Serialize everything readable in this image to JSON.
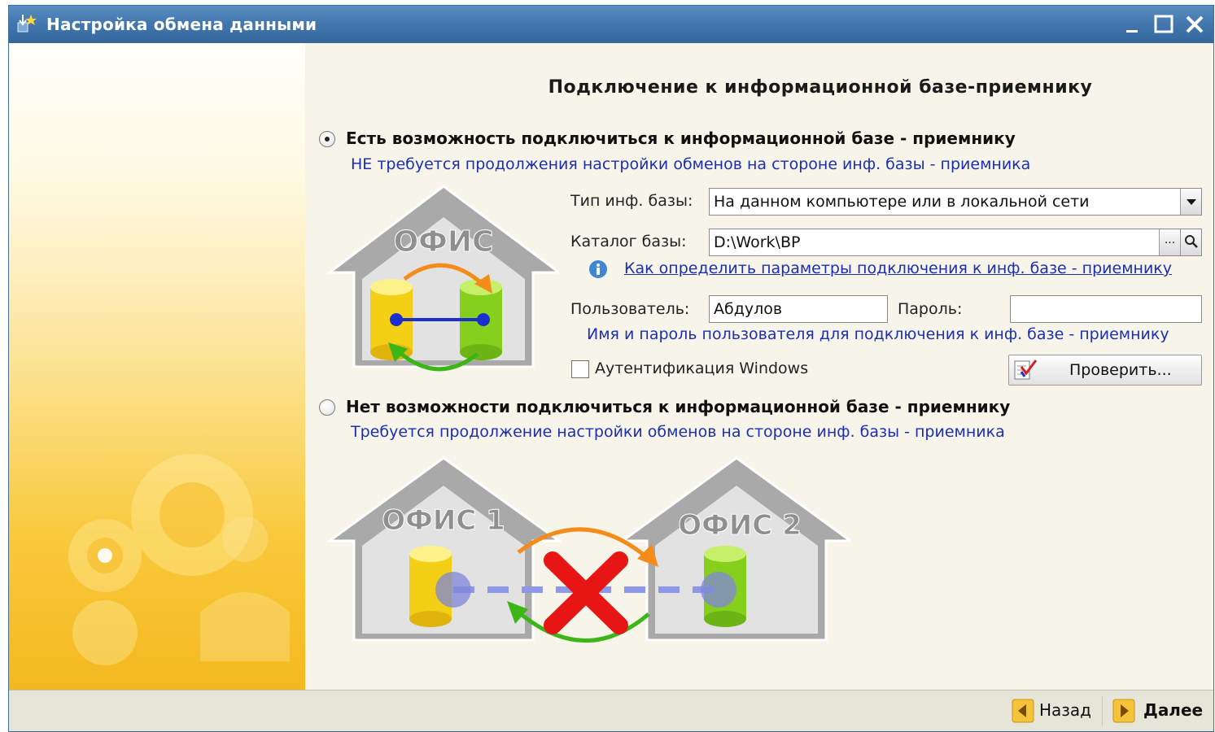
{
  "window": {
    "title": "Настройка обмена данными",
    "controls": [
      "minimize-icon",
      "maximize-icon",
      "close-icon"
    ]
  },
  "heading": "Подключение к информационной базе-приемнику",
  "option_connect": {
    "selected": true,
    "title": "Есть возможность подключиться к информационной базе - приемнику",
    "hint": "НЕ требуется продолжения настройки обменов на стороне инф. базы - приемника",
    "illustration_label": "ОФИС"
  },
  "form": {
    "db_type_label": "Тип инф. базы:",
    "db_type_value": "На данном компьютере или в локальной сети",
    "catalog_label": "Каталог базы:",
    "catalog_value": "D:\\Work\\BP",
    "browse_label": "...",
    "help_link": "Как определить параметры подключения к инф. базе - приемнику",
    "user_label": "Пользователь:",
    "user_value": "Абдулов",
    "password_label": "Пароль:",
    "password_value": "",
    "credentials_hint": "Имя и пароль пользователя для подключения к инф. базе - приемнику",
    "windows_auth_label": "Аутентификация Windows",
    "windows_auth_checked": false,
    "check_button": "Проверить..."
  },
  "option_no_connect": {
    "selected": false,
    "title": "Нет возможности подключиться к информационной базе - приемнику",
    "hint": "Требуется продолжение настройки обменов на стороне инф. базы - приемника",
    "office1_label": "ОФИС 1",
    "office2_label": "ОФИС 2"
  },
  "nav": {
    "back_label": "Назад",
    "next_label": "Далее"
  },
  "colors": {
    "titlebar": "#4378ae",
    "hint_text": "#1c2fb0",
    "accent_yellow": "#f4b81f"
  }
}
